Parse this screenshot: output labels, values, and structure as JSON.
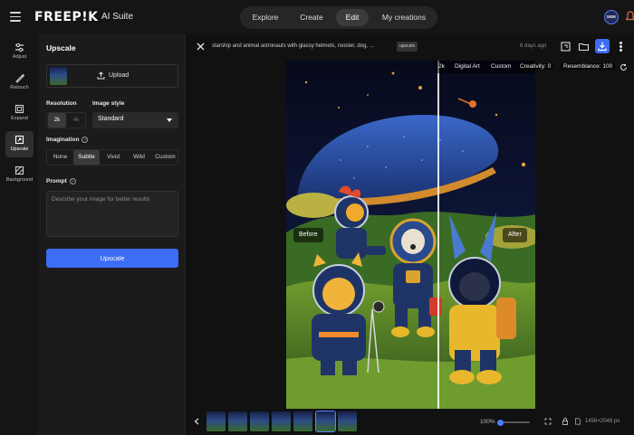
{
  "header": {
    "logo": "FREEP!K",
    "logo_sub": "AI Suite",
    "nav": [
      {
        "label": "Explore"
      },
      {
        "label": "Create"
      },
      {
        "label": "Edit",
        "active": true
      },
      {
        "label": "My creations"
      }
    ],
    "credits_badge": "192K"
  },
  "rail": {
    "items": [
      {
        "label": "Adjust",
        "icon": "sliders-icon"
      },
      {
        "label": "Retouch",
        "icon": "brush-icon"
      },
      {
        "label": "Expand",
        "icon": "expand-icon"
      },
      {
        "label": "Upscale",
        "icon": "upscale-icon",
        "active": true
      },
      {
        "label": "Background",
        "icon": "background-icon"
      }
    ]
  },
  "panel": {
    "title": "Upscale",
    "upload_label": "Upload",
    "resolution_label": "Resolution",
    "resolution_options": [
      "2k",
      "4k"
    ],
    "resolution_selected": "2k",
    "style_label": "Image style",
    "style_value": "Standard",
    "imagination_label": "Imagination",
    "imagination_options": [
      "None",
      "Subtle",
      "Vivid",
      "Wild",
      "Custom"
    ],
    "imagination_selected": "Subtle",
    "prompt_label": "Prompt",
    "prompt_placeholder": "Describe your image for better results",
    "button_label": "Upscale"
  },
  "main": {
    "description": "starship and animal astronauts with glassy helmets, rooster, dog, ...",
    "tag": "upscale",
    "time_ago": "6 days ago",
    "info": {
      "res": "2k",
      "style": "Digital Art",
      "mode": "Custom",
      "creativity": "Creativity: 0",
      "resemblance": "Resemblance: 100"
    },
    "before_label": "Before",
    "after_label": "After",
    "compare_position": 0.61
  },
  "footer": {
    "thumb_count": 7,
    "selected_thumb": 5,
    "zoom": "100%",
    "zoom_level": 0.1,
    "dimensions": "1456×2048 px"
  },
  "colors": {
    "accent": "#3d6cf5",
    "background": "#151515"
  }
}
